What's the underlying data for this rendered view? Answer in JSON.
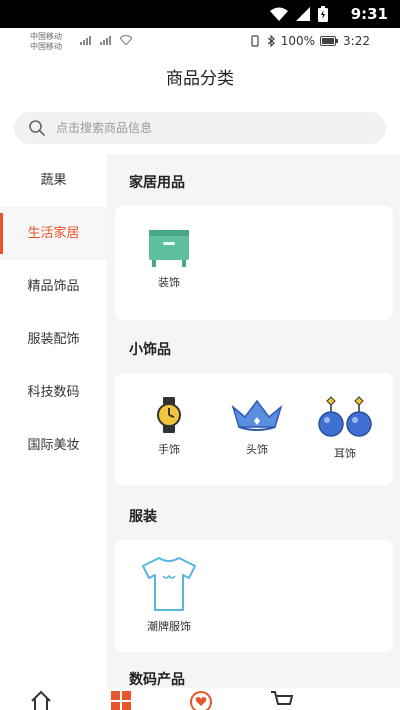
{
  "system": {
    "time": "9:31"
  },
  "status": {
    "carrier1": "中国移动",
    "carrier2": "中国移动",
    "battery": "100%",
    "time": "3:22"
  },
  "header": {
    "title": "商品分类"
  },
  "search": {
    "placeholder": "点击搜索商品信息"
  },
  "sidebar": {
    "items": [
      {
        "label": "蔬果"
      },
      {
        "label": "生活家居"
      },
      {
        "label": "精品饰品"
      },
      {
        "label": "服装配饰"
      },
      {
        "label": "科技数码"
      },
      {
        "label": "国际美妆"
      }
    ],
    "active_index": 1
  },
  "sections": [
    {
      "title": "家居用品",
      "items": [
        {
          "label": "装饰",
          "icon": "cabinet-icon"
        }
      ]
    },
    {
      "title": "小饰品",
      "items": [
        {
          "label": "手饰",
          "icon": "watch-icon"
        },
        {
          "label": "头饰",
          "icon": "crown-icon"
        },
        {
          "label": "耳饰",
          "icon": "earring-icon"
        }
      ]
    },
    {
      "title": "服装",
      "items": [
        {
          "label": "潮牌服饰",
          "icon": "tshirt-icon"
        }
      ]
    },
    {
      "title": "数码产品",
      "items": []
    }
  ],
  "colors": {
    "accent": "#e8552b",
    "background": "#f5f5f5",
    "teal": "#5fbf9f",
    "blue": "#3f6fd1",
    "gold": "#f2c53d"
  },
  "tabbar": {
    "icons": [
      "home-icon",
      "category-icon",
      "heart-icon",
      "cart-icon"
    ]
  }
}
